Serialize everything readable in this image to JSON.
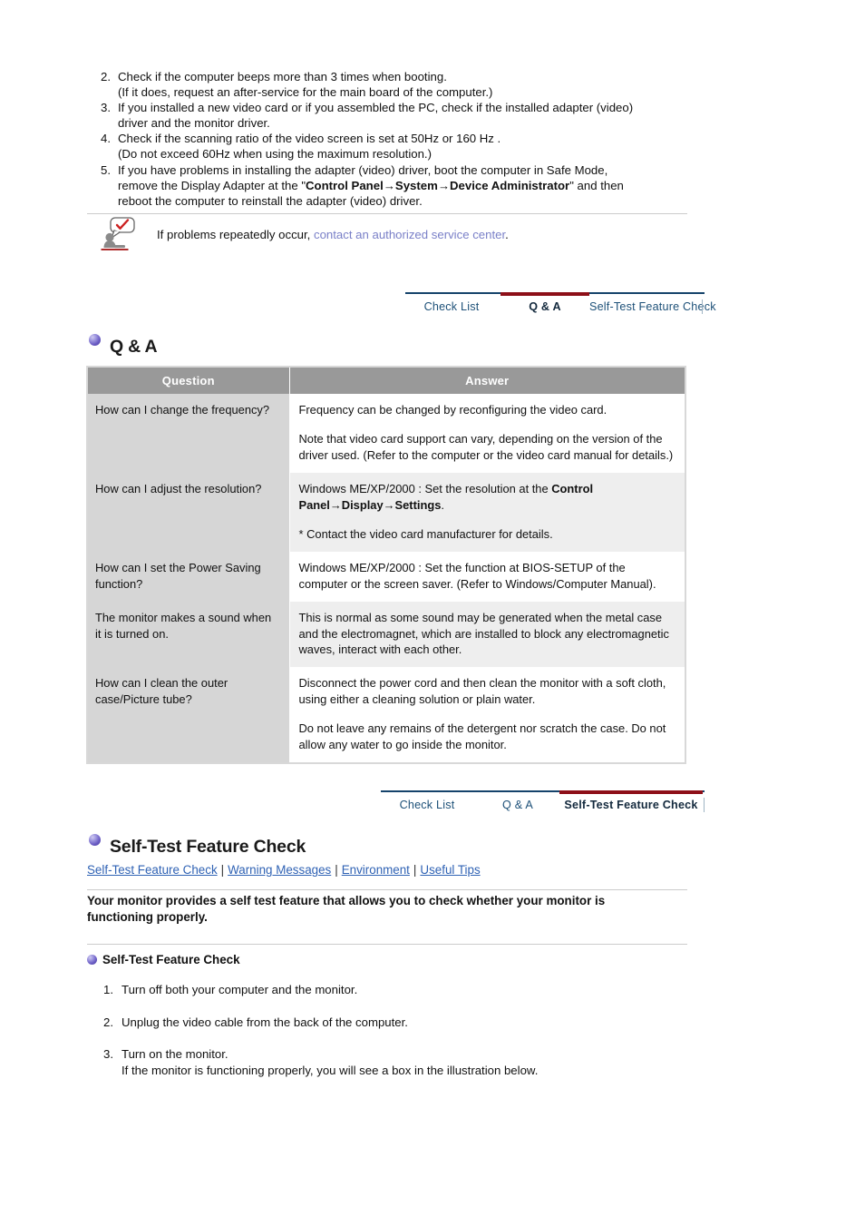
{
  "colors": {
    "tab_active_bar": "#8d0f18",
    "tab_text": "#1d5078",
    "table_header_bg": "#999999",
    "question_bg": "#d6d6d6",
    "link_blue": "#2f62b4",
    "notice_link": "#7a80c8",
    "bullet_purple": "#6a5cc4"
  },
  "troubleshoot_list": [
    {
      "num": "2.",
      "lines": [
        "Check if the computer beeps more than 3 times when booting.",
        "(If it does, request an after-service for the main board of the computer.)"
      ]
    },
    {
      "num": "3.",
      "lines": [
        "If you installed a new video card or if you assembled the PC, check if the installed adapter (video)",
        "driver and the monitor driver."
      ]
    },
    {
      "num": "4.",
      "lines": [
        "Check if the scanning ratio of the video screen is set at 50Hz or 160 Hz .",
        "(Do not exceed 60Hz when using the maximum resolution.)"
      ]
    },
    {
      "num": "5.",
      "lines": [
        "If you have problems in installing the adapter (video) driver, boot the computer in Safe Mode,",
        "remove the Display Adapter at the \"Control Panel→System→Device Administrator\" and then",
        "reboot the computer to reinstall the adapter (video) driver."
      ],
      "line2_prefix": "remove the Display Adapter at the \"",
      "line2_bold": "Control Panel→System→Device Administrator",
      "line2_suffix": "\" and then"
    }
  ],
  "notice": {
    "icon": "person-speech-check-icon",
    "text_before": "If problems repeatedly occur, ",
    "link_text": "contact an authorized service center",
    "text_after": "."
  },
  "tabbar_qa": {
    "tabs": [
      {
        "label": "Check List",
        "active": false
      },
      {
        "label": "Q & A",
        "active": true
      },
      {
        "label": "Self-Test Feature Check",
        "active": false
      }
    ]
  },
  "tabbar_selftest": {
    "tabs": [
      {
        "label": "Check List",
        "active": false
      },
      {
        "label": "Q & A",
        "active": false
      },
      {
        "label": "Self-Test Feature Check",
        "active": true
      }
    ]
  },
  "qa_section": {
    "heading": "Q & A",
    "columns": [
      "Question",
      "Answer"
    ],
    "rows": [
      {
        "question": "How can I change the frequency?",
        "answer_paragraphs": [
          "Frequency can be changed by reconfiguring the video card.",
          "Note that video card support can vary, depending on the version of the driver used. (Refer to the computer or the video card manual for details.)"
        ]
      },
      {
        "question": "How can I adjust the resolution?",
        "answer_paragraphs": [
          "Windows ME/XP/2000 : Set the resolution at the Control Panel→Display→Settings.",
          "* Contact the video card manufacturer for details."
        ],
        "answer_rich": {
          "p1_prefix": "Windows ME/XP/2000 : Set the resolution at the ",
          "p1_bold": "Control Panel→Display→Settings",
          "p1_suffix": "."
        }
      },
      {
        "question": "How can I set the Power Saving function?",
        "answer_paragraphs": [
          "Windows ME/XP/2000 : Set the function at BIOS-SETUP of the computer or the screen saver. (Refer to Windows/Computer Manual)."
        ]
      },
      {
        "question": "The monitor makes a sound when it is turned on.",
        "answer_paragraphs": [
          "This is normal as some sound may be generated when the metal case and the electromagnet, which are installed to block any electromagnetic waves, interact with each other."
        ]
      },
      {
        "question": "How can I clean the outer case/Picture tube?",
        "answer_paragraphs": [
          "Disconnect the power cord and then clean the monitor with a soft cloth, using either a cleaning solution or plain water.",
          "Do not leave any remains of the detergent nor scratch the case. Do not allow any water to go inside the monitor."
        ]
      }
    ]
  },
  "selftest_section": {
    "heading": "Self-Test Feature Check",
    "sublinks": [
      "Self-Test Feature Check",
      "Warning Messages",
      "Environment",
      "Useful Tips"
    ],
    "separator": "|",
    "lead_line1": "Your monitor provides a self test feature that allows you to check whether your monitor is",
    "lead_line2": "functioning properly.",
    "subheading": "Self-Test Feature Check",
    "steps": [
      {
        "num": "1.",
        "lines": [
          "Turn off both your computer and the monitor."
        ]
      },
      {
        "num": "2.",
        "lines": [
          "Unplug the video cable from the back of the computer."
        ]
      },
      {
        "num": "3.",
        "lines": [
          "Turn on the monitor.",
          "If the monitor is functioning properly, you will see a box in the illustration below."
        ]
      }
    ]
  }
}
